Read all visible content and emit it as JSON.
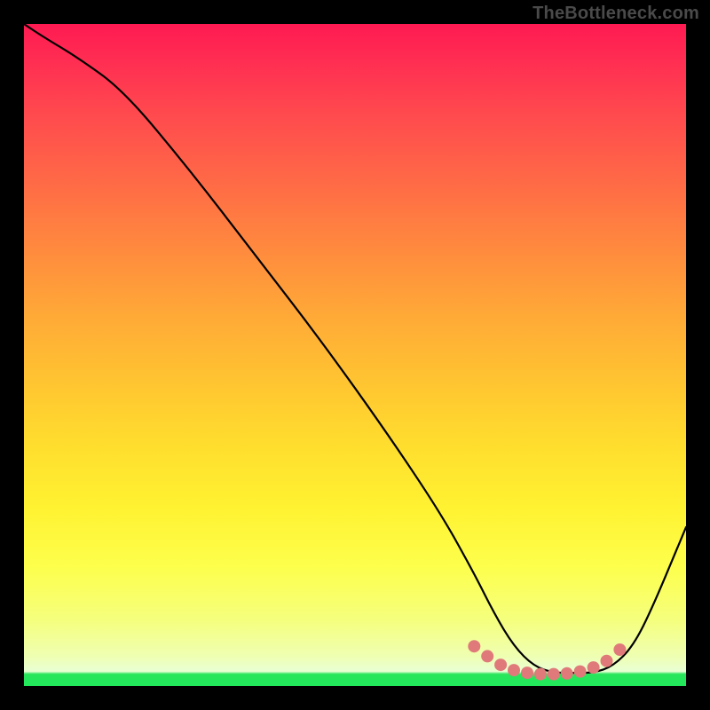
{
  "watermark": "TheBottleneck.com",
  "chart_data": {
    "type": "line",
    "title": "",
    "xlabel": "",
    "ylabel": "",
    "xlim": [
      0,
      100
    ],
    "ylim": [
      0,
      100
    ],
    "grid": false,
    "series": [
      {
        "name": "bottleneck-curve",
        "color": "#000000",
        "x": [
          0,
          3,
          8,
          15,
          25,
          35,
          45,
          55,
          63,
          68,
          71,
          74,
          77,
          80,
          83,
          86,
          89,
          92,
          95,
          100
        ],
        "y": [
          100,
          98,
          95,
          90,
          78,
          65,
          52,
          38,
          26,
          17,
          11,
          6,
          3,
          2,
          2,
          2,
          3,
          6,
          12,
          24
        ]
      }
    ],
    "highlight": {
      "name": "optimal-zone",
      "color": "#e07a7a",
      "x": [
        68,
        70,
        72,
        74,
        76,
        78,
        80,
        82,
        84,
        86,
        88,
        90
      ],
      "y": [
        6,
        4.5,
        3.2,
        2.4,
        2.0,
        1.8,
        1.8,
        1.9,
        2.2,
        2.8,
        3.8,
        5.5
      ]
    },
    "gradient_stops": [
      {
        "pos": 0,
        "color": "#ff1a52"
      },
      {
        "pos": 50,
        "color": "#ffb734"
      },
      {
        "pos": 90,
        "color": "#f5ff7d"
      },
      {
        "pos": 98,
        "color": "#e8ffd4"
      },
      {
        "pos": 100,
        "color": "#22e85b"
      }
    ]
  }
}
